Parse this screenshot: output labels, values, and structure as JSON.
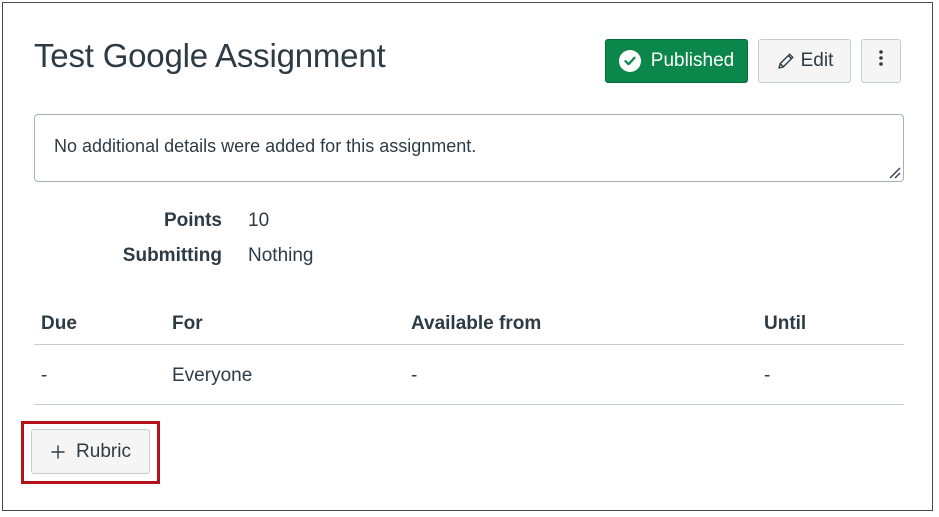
{
  "assignment": {
    "title": "Test Google Assignment"
  },
  "header_actions": {
    "published_label": "Published",
    "edit_label": "Edit",
    "published_color": "#0b874b"
  },
  "details": {
    "description": "No additional details were added for this assignment."
  },
  "meta": {
    "points_label": "Points",
    "points_value": "10",
    "submitting_label": "Submitting",
    "submitting_value": "Nothing"
  },
  "dates_table": {
    "headers": [
      "Due",
      "For",
      "Available from",
      "Until"
    ],
    "rows": [
      [
        "-",
        "Everyone",
        "-",
        "-"
      ]
    ]
  },
  "rubric": {
    "button_label": "Rubric",
    "highlight_color": "#b3121a"
  },
  "icons": {
    "published": "check-circle-icon",
    "edit": "pencil-icon",
    "more": "kebab-menu-icon",
    "rubric": "plus-icon",
    "resize": "resize-handle-icon"
  }
}
